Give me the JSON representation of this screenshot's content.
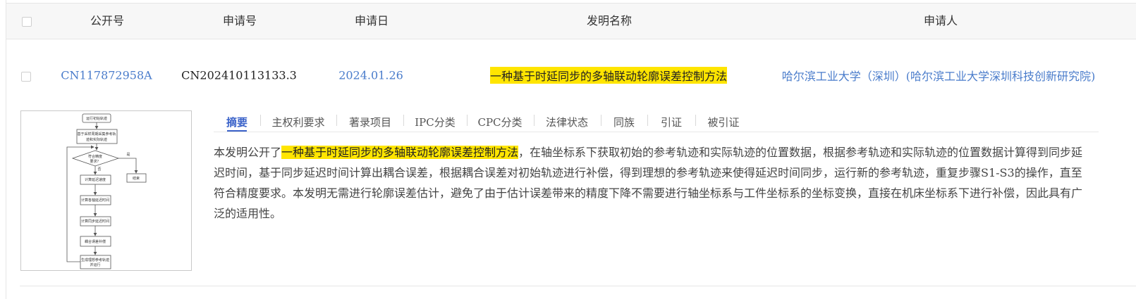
{
  "header": {
    "col_pub": "公开号",
    "col_app": "申请号",
    "col_date": "申请日",
    "col_title": "发明名称",
    "col_applicant": "申请人"
  },
  "row": {
    "pub_no": "CN117872958A",
    "app_no": "CN202410113133.3",
    "app_date": "2024.01.26",
    "title": "一种基于时延同步的多轴联动轮廓误差控制方法",
    "applicant": "哈尔滨工业大学（深圳）(哈尔滨工业大学深圳科技创新研究院)"
  },
  "tabs": [
    "摘要",
    "主权利要求",
    "著录项目",
    "IPC分类",
    "CPC分类",
    "法律状态",
    "同族",
    "引证",
    "被引证"
  ],
  "abstract": {
    "prefix": "本发明公开了",
    "highlight": "一种基于时延同步的多轴联动轮廓误差控制方法",
    "rest": "，在轴坐标系下获取初始的参考轨迹和实际轨迹的位置数据，根据参考轨迹和实际轨迹的位置数据计算得到同步延迟时间，基于同步延迟时间计算出耦合误差，根据耦合误差对初始轨迹进行补偿，得到理想的参考轨迹来使得延迟时间同步，运行新的参考轨迹，重复步骤S1-S3的操作，直至符合精度要求。本发明无需进行轮廓误差估计，避免了由于估计误差带来的精度下降不需要进行轴坐标系与工件坐标系的坐标变换，直接在机床坐标系下进行补偿，因此具有广泛的适用性。"
  },
  "flowchart": {
    "n1": "运行初始轨迹",
    "n2a": "基于采样周期采集参考轨",
    "n2b": "迹和实际轨迹",
    "n3a": "符合精度",
    "n3b": "要求？",
    "yes": "是",
    "no": "否",
    "end": "结束",
    "n4": "计算延迟速度",
    "n5": "计算各轴延迟时间",
    "n6": "计算同步延迟时间",
    "n7": "耦合误差补偿",
    "n8a": "生成理想参考轨迹",
    "n8b": "并运行"
  },
  "colors": {
    "link": "#4a7ccb",
    "highlight": "#ffe500",
    "tab_active": "#3a62c9"
  }
}
